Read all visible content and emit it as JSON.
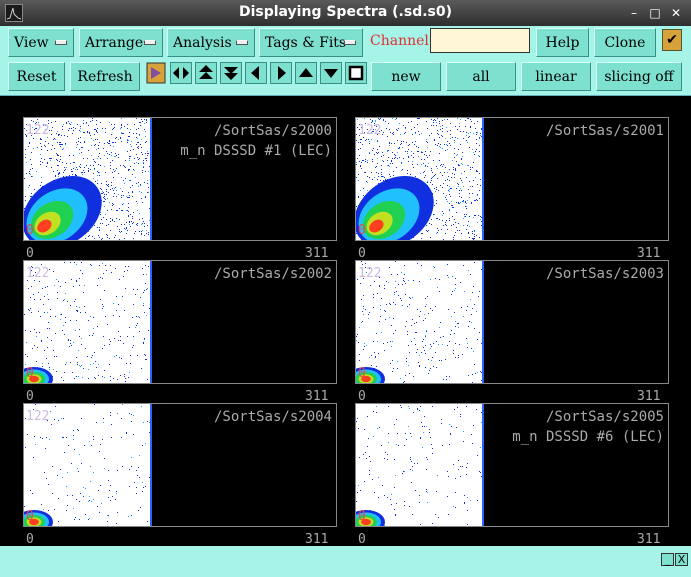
{
  "window": {
    "title": "Displaying Spectra (.sd.s0)",
    "controls": {
      "minimize": "–",
      "maximize": "□",
      "close": "✕"
    }
  },
  "toolbar": {
    "menus": [
      {
        "label": "View"
      },
      {
        "label": "Arrange"
      },
      {
        "label": "Analysis"
      },
      {
        "label": "Tags & Fits"
      }
    ],
    "channel_label": "Channel:",
    "channel_value": "",
    "help_label": "Help",
    "clone_label": "Clone",
    "checkbox_mark": "✔",
    "reset_label": "Reset",
    "refresh_label": "Refresh",
    "icon_buttons": [
      "expand-horizontal-icon",
      "double-arrow-up-icon",
      "double-arrow-down-icon",
      "arrow-left-icon",
      "arrow-right-icon",
      "arrow-up-icon",
      "arrow-down-icon",
      "stop-square-icon"
    ],
    "new_label": "new",
    "all_label": "all",
    "linear_label": "linear",
    "slicing_label": "slicing off"
  },
  "colors": {
    "toolbar_bg": "#a6f3e8",
    "button_bg": "#7ee0cf",
    "channel_label": "#e03030"
  },
  "spectra": [
    {
      "path": "/SortSas/s2000",
      "subtitle": "m_n DSSSD #1 (LEC)",
      "ymax": "122",
      "ymin": "0",
      "xmin": "0",
      "xmax": "311",
      "density": 1.0
    },
    {
      "path": "/SortSas/s2001",
      "subtitle": "",
      "ymax": "122",
      "ymin": "0",
      "xmin": "0",
      "xmax": "311",
      "density": 1.0
    },
    {
      "path": "/SortSas/s2002",
      "subtitle": "",
      "ymax": "122",
      "ymin": "0",
      "xmin": "0",
      "xmax": "311",
      "density": 0.35
    },
    {
      "path": "/SortSas/s2003",
      "subtitle": "",
      "ymax": "122",
      "ymin": "0",
      "xmin": "0",
      "xmax": "311",
      "density": 0.35
    },
    {
      "path": "/SortSas/s2004",
      "subtitle": "",
      "ymax": "122",
      "ymin": "0",
      "xmin": "0",
      "xmax": "311",
      "density": 0.2
    },
    {
      "path": "/SortSas/s2005",
      "subtitle": "m_n DSSSD #6 (LEC)",
      "ymax": "",
      "ymin": "0",
      "xmin": "0",
      "xmax": "311",
      "density": 0.2
    }
  ],
  "statusbar": {
    "min_btn": "_",
    "close_btn": "X"
  }
}
